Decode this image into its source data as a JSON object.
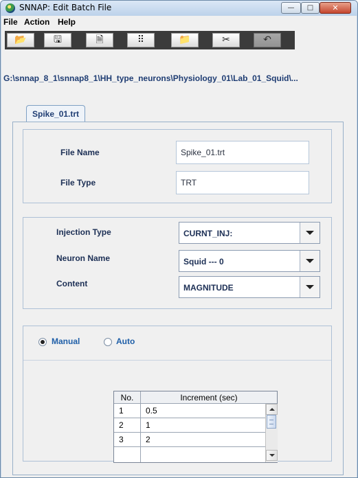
{
  "window": {
    "title": "SNNAP: Edit Batch File",
    "controls": {
      "minimize": "—",
      "maximize": "□",
      "close": "✕"
    }
  },
  "menu": [
    "File",
    "Action",
    "Help"
  ],
  "toolbar": {
    "buttons": [
      {
        "icon": "open-folder-icon",
        "glyph": "📂"
      },
      {
        "icon": "save-icon",
        "glyph": "🖫"
      },
      {
        "icon": "document-icon",
        "glyph": "🗎"
      },
      {
        "icon": "tree-icon",
        "glyph": "⠿"
      },
      {
        "icon": "add-folder-icon",
        "glyph": "📁"
      },
      {
        "icon": "cut-icon",
        "glyph": "✂"
      },
      {
        "icon": "undo-icon",
        "glyph": "↶"
      }
    ]
  },
  "path": "G:\\snnap_8_1\\snnap8_1\\HH_type_neurons\\Physiology_01\\Lab_01_Squid\\...",
  "tab": {
    "label": "Spike_01.trt"
  },
  "file": {
    "name_label": "File Name",
    "name_value": "Spike_01.trt",
    "type_label": "File Type",
    "type_value": "TRT"
  },
  "injection": {
    "injection_type_label": "Injection Type",
    "injection_type_value": "CURNT_INJ:",
    "neuron_name_label": "Neuron Name",
    "neuron_name_value": "Squid --- 0",
    "content_label": "Content",
    "content_value": "MAGNITUDE"
  },
  "mode": {
    "manual_label": "Manual",
    "auto_label": "Auto",
    "selected": "Manual"
  },
  "table": {
    "headers": [
      "No.",
      "Increment (sec)"
    ],
    "rows": [
      [
        "1",
        "0.5"
      ],
      [
        "2",
        "1"
      ],
      [
        "3",
        "2"
      ]
    ]
  }
}
